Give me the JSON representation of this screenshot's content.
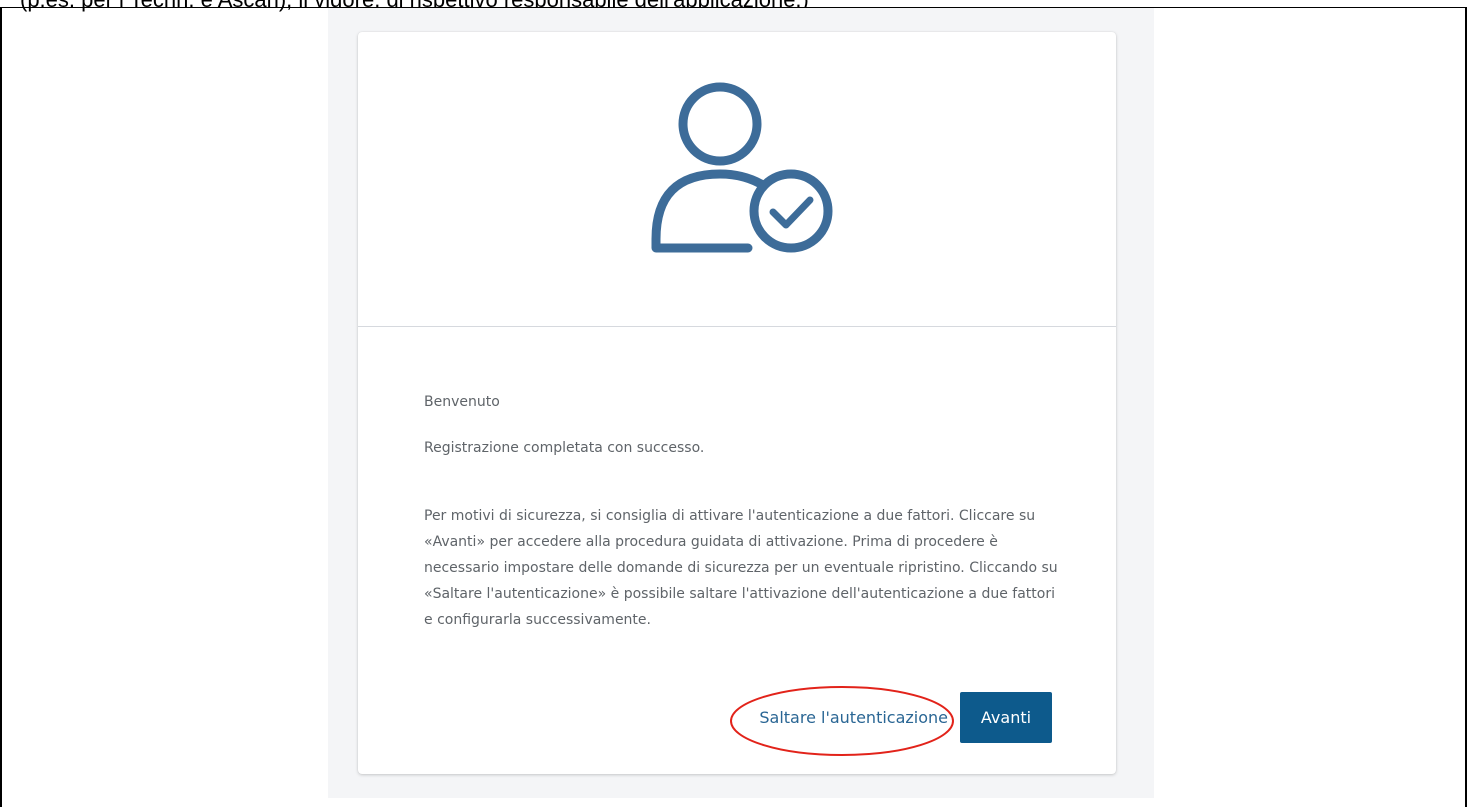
{
  "caption": {
    "text": "(p.es. per i Techn. e Ascan), il vigore. di rispettivo responsabile dell'applicazione.)"
  },
  "card": {
    "icon": "user-check-icon",
    "greeting": "Benvenuto",
    "success_message": "Registrazione completata con successo.",
    "info_text": "Per motivi di sicurezza, si consiglia di attivare l'autenticazione a due fattori. Cliccare su «Avanti» per accedere alla procedura guidata di attivazione. Prima di procedere è necessario impostare delle domande di sicurezza per un eventuale ripristino. Cliccando su «Saltare l'autenticazione» è possibile saltare l'attivazione dell'autenticazione a due fattori e configurarla successivamente.",
    "skip_label": "Saltare l'autenticazione",
    "next_label": "Avanti"
  },
  "colors": {
    "icon": "#3d6c99",
    "link": "#2a6694",
    "primary_button": "#0d5a8c",
    "highlight": "#e2231a"
  }
}
